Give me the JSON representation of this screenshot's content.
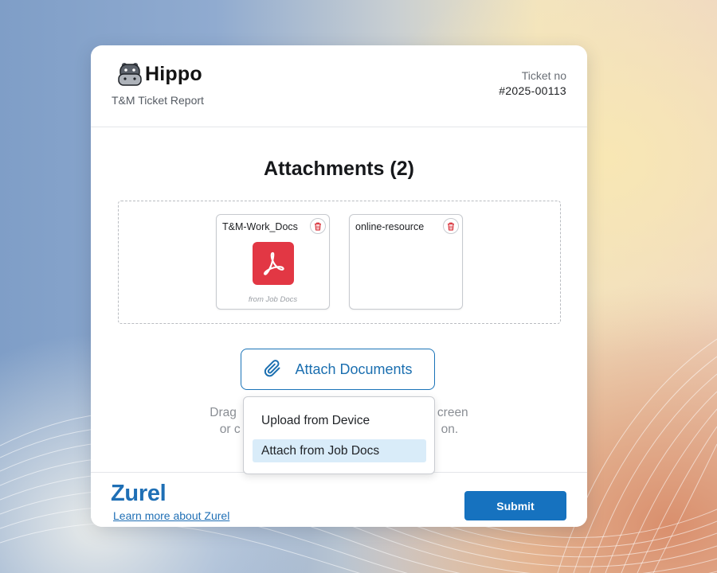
{
  "brand": {
    "name": "Hippo",
    "report_title": "T&M Ticket Report",
    "logo_icon": "hippo-icon"
  },
  "ticket": {
    "label": "Ticket no",
    "number": "#2025-00113"
  },
  "attachments": {
    "title": "Attachments (2)",
    "files": [
      {
        "name": "T&M-Work_Docs",
        "type": "pdf",
        "icon": "pdf-icon",
        "source": "from Job Docs",
        "delete_icon": "trash-icon"
      },
      {
        "name": "online-resource",
        "type": "link",
        "icon": "",
        "source": "",
        "delete_icon": "trash-icon"
      }
    ]
  },
  "attach_button": {
    "label": "Attach Documents",
    "icon": "paperclip-icon"
  },
  "helper_text": {
    "line1_left": "Drag",
    "line1_right": "creen",
    "line2_left": "or c",
    "line2_right": "on."
  },
  "dropdown": {
    "items": [
      {
        "label": "Upload from Device",
        "highlighted": false
      },
      {
        "label": "Attach from Job Docs",
        "highlighted": true
      }
    ]
  },
  "footer": {
    "company_logo_text": "Zurel",
    "learn_more": "Learn more about Zurel",
    "submit_label": "Submit"
  },
  "colors": {
    "accent": "#1a73b8",
    "pdf_red": "#e23744",
    "delete_red": "#d9363e",
    "menu_highlight": "#d9ecf9"
  }
}
